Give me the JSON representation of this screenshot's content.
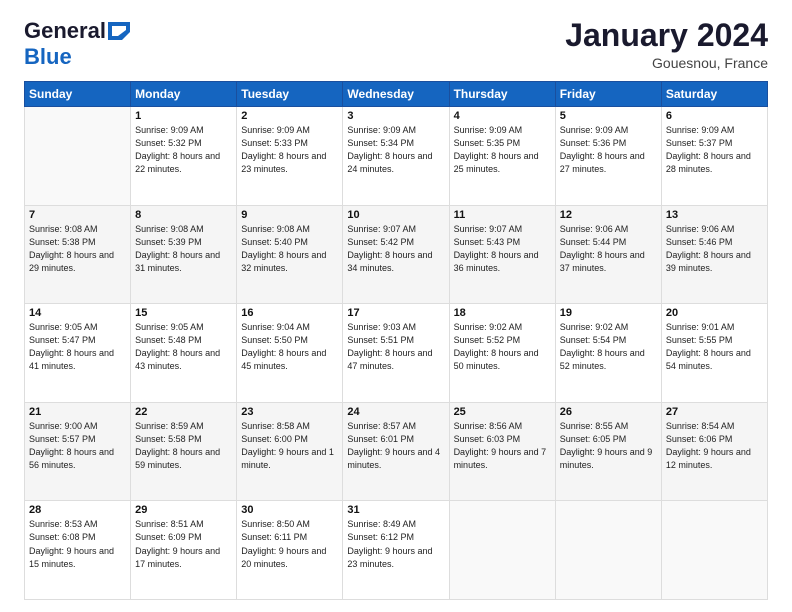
{
  "header": {
    "logo_general": "General",
    "logo_blue": "Blue",
    "month": "January 2024",
    "location": "Gouesnou, France"
  },
  "days_of_week": [
    "Sunday",
    "Monday",
    "Tuesday",
    "Wednesday",
    "Thursday",
    "Friday",
    "Saturday"
  ],
  "weeks": [
    [
      {
        "num": "",
        "sunrise": "",
        "sunset": "",
        "daylight": ""
      },
      {
        "num": "1",
        "sunrise": "Sunrise: 9:09 AM",
        "sunset": "Sunset: 5:32 PM",
        "daylight": "Daylight: 8 hours and 22 minutes."
      },
      {
        "num": "2",
        "sunrise": "Sunrise: 9:09 AM",
        "sunset": "Sunset: 5:33 PM",
        "daylight": "Daylight: 8 hours and 23 minutes."
      },
      {
        "num": "3",
        "sunrise": "Sunrise: 9:09 AM",
        "sunset": "Sunset: 5:34 PM",
        "daylight": "Daylight: 8 hours and 24 minutes."
      },
      {
        "num": "4",
        "sunrise": "Sunrise: 9:09 AM",
        "sunset": "Sunset: 5:35 PM",
        "daylight": "Daylight: 8 hours and 25 minutes."
      },
      {
        "num": "5",
        "sunrise": "Sunrise: 9:09 AM",
        "sunset": "Sunset: 5:36 PM",
        "daylight": "Daylight: 8 hours and 27 minutes."
      },
      {
        "num": "6",
        "sunrise": "Sunrise: 9:09 AM",
        "sunset": "Sunset: 5:37 PM",
        "daylight": "Daylight: 8 hours and 28 minutes."
      }
    ],
    [
      {
        "num": "7",
        "sunrise": "Sunrise: 9:08 AM",
        "sunset": "Sunset: 5:38 PM",
        "daylight": "Daylight: 8 hours and 29 minutes."
      },
      {
        "num": "8",
        "sunrise": "Sunrise: 9:08 AM",
        "sunset": "Sunset: 5:39 PM",
        "daylight": "Daylight: 8 hours and 31 minutes."
      },
      {
        "num": "9",
        "sunrise": "Sunrise: 9:08 AM",
        "sunset": "Sunset: 5:40 PM",
        "daylight": "Daylight: 8 hours and 32 minutes."
      },
      {
        "num": "10",
        "sunrise": "Sunrise: 9:07 AM",
        "sunset": "Sunset: 5:42 PM",
        "daylight": "Daylight: 8 hours and 34 minutes."
      },
      {
        "num": "11",
        "sunrise": "Sunrise: 9:07 AM",
        "sunset": "Sunset: 5:43 PM",
        "daylight": "Daylight: 8 hours and 36 minutes."
      },
      {
        "num": "12",
        "sunrise": "Sunrise: 9:06 AM",
        "sunset": "Sunset: 5:44 PM",
        "daylight": "Daylight: 8 hours and 37 minutes."
      },
      {
        "num": "13",
        "sunrise": "Sunrise: 9:06 AM",
        "sunset": "Sunset: 5:46 PM",
        "daylight": "Daylight: 8 hours and 39 minutes."
      }
    ],
    [
      {
        "num": "14",
        "sunrise": "Sunrise: 9:05 AM",
        "sunset": "Sunset: 5:47 PM",
        "daylight": "Daylight: 8 hours and 41 minutes."
      },
      {
        "num": "15",
        "sunrise": "Sunrise: 9:05 AM",
        "sunset": "Sunset: 5:48 PM",
        "daylight": "Daylight: 8 hours and 43 minutes."
      },
      {
        "num": "16",
        "sunrise": "Sunrise: 9:04 AM",
        "sunset": "Sunset: 5:50 PM",
        "daylight": "Daylight: 8 hours and 45 minutes."
      },
      {
        "num": "17",
        "sunrise": "Sunrise: 9:03 AM",
        "sunset": "Sunset: 5:51 PM",
        "daylight": "Daylight: 8 hours and 47 minutes."
      },
      {
        "num": "18",
        "sunrise": "Sunrise: 9:02 AM",
        "sunset": "Sunset: 5:52 PM",
        "daylight": "Daylight: 8 hours and 50 minutes."
      },
      {
        "num": "19",
        "sunrise": "Sunrise: 9:02 AM",
        "sunset": "Sunset: 5:54 PM",
        "daylight": "Daylight: 8 hours and 52 minutes."
      },
      {
        "num": "20",
        "sunrise": "Sunrise: 9:01 AM",
        "sunset": "Sunset: 5:55 PM",
        "daylight": "Daylight: 8 hours and 54 minutes."
      }
    ],
    [
      {
        "num": "21",
        "sunrise": "Sunrise: 9:00 AM",
        "sunset": "Sunset: 5:57 PM",
        "daylight": "Daylight: 8 hours and 56 minutes."
      },
      {
        "num": "22",
        "sunrise": "Sunrise: 8:59 AM",
        "sunset": "Sunset: 5:58 PM",
        "daylight": "Daylight: 8 hours and 59 minutes."
      },
      {
        "num": "23",
        "sunrise": "Sunrise: 8:58 AM",
        "sunset": "Sunset: 6:00 PM",
        "daylight": "Daylight: 9 hours and 1 minute."
      },
      {
        "num": "24",
        "sunrise": "Sunrise: 8:57 AM",
        "sunset": "Sunset: 6:01 PM",
        "daylight": "Daylight: 9 hours and 4 minutes."
      },
      {
        "num": "25",
        "sunrise": "Sunrise: 8:56 AM",
        "sunset": "Sunset: 6:03 PM",
        "daylight": "Daylight: 9 hours and 7 minutes."
      },
      {
        "num": "26",
        "sunrise": "Sunrise: 8:55 AM",
        "sunset": "Sunset: 6:05 PM",
        "daylight": "Daylight: 9 hours and 9 minutes."
      },
      {
        "num": "27",
        "sunrise": "Sunrise: 8:54 AM",
        "sunset": "Sunset: 6:06 PM",
        "daylight": "Daylight: 9 hours and 12 minutes."
      }
    ],
    [
      {
        "num": "28",
        "sunrise": "Sunrise: 8:53 AM",
        "sunset": "Sunset: 6:08 PM",
        "daylight": "Daylight: 9 hours and 15 minutes."
      },
      {
        "num": "29",
        "sunrise": "Sunrise: 8:51 AM",
        "sunset": "Sunset: 6:09 PM",
        "daylight": "Daylight: 9 hours and 17 minutes."
      },
      {
        "num": "30",
        "sunrise": "Sunrise: 8:50 AM",
        "sunset": "Sunset: 6:11 PM",
        "daylight": "Daylight: 9 hours and 20 minutes."
      },
      {
        "num": "31",
        "sunrise": "Sunrise: 8:49 AM",
        "sunset": "Sunset: 6:12 PM",
        "daylight": "Daylight: 9 hours and 23 minutes."
      },
      {
        "num": "",
        "sunrise": "",
        "sunset": "",
        "daylight": ""
      },
      {
        "num": "",
        "sunrise": "",
        "sunset": "",
        "daylight": ""
      },
      {
        "num": "",
        "sunrise": "",
        "sunset": "",
        "daylight": ""
      }
    ]
  ]
}
